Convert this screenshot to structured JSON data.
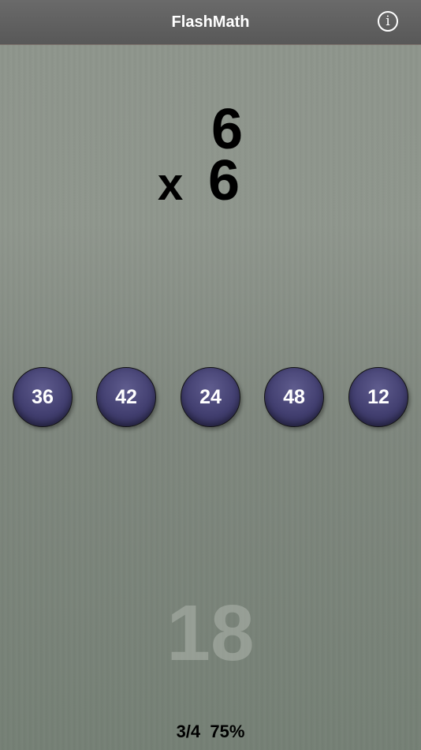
{
  "navbar": {
    "title": "FlashMath",
    "info_glyph": "i",
    "info_icon": "info-icon"
  },
  "problem": {
    "top_operand": "6",
    "operator": "x",
    "bottom_operand": "6"
  },
  "answers": [
    "36",
    "42",
    "24",
    "48",
    "12"
  ],
  "previous_answer": "18",
  "score": {
    "fraction": "3/4",
    "percent": "75%"
  },
  "colors": {
    "navbar": "#5e5e5e",
    "background": "#8a9188",
    "answer_button": "#423f70",
    "answer_text": "#ffffff"
  }
}
